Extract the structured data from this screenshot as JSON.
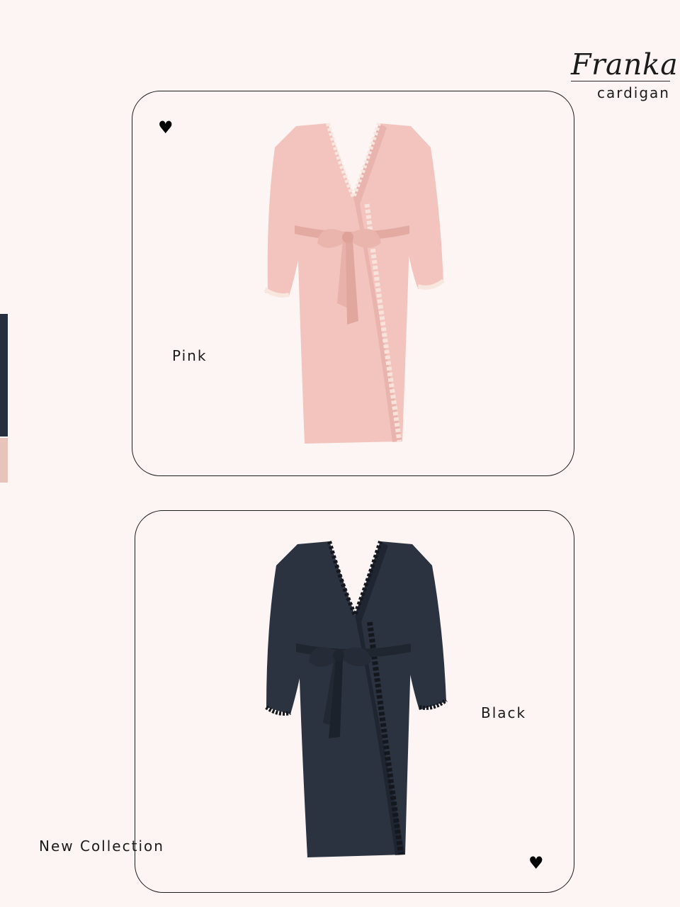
{
  "brand": {
    "title": "Franka",
    "subtitle": "cardigan"
  },
  "products": [
    {
      "color_label": "Pink",
      "fabric_color": "#f2c4bd",
      "shade_color": "#e3aaa2",
      "lace_color": "#f8e7df"
    },
    {
      "color_label": "Black",
      "fabric_color": "#2c3340",
      "shade_color": "#1b212b",
      "lace_color": "#14171d"
    }
  ],
  "footer": {
    "collection_label": "New Collection"
  },
  "swatches": [
    "#262f3f",
    "#e7c3bc"
  ],
  "icons": [
    "heart-icon",
    "heart-icon"
  ],
  "colors": {
    "background": "#fcf5f3",
    "ink": "#1b1b1b"
  }
}
